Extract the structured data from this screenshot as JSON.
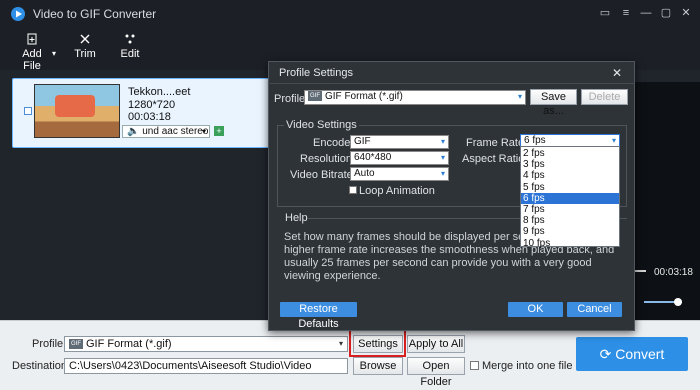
{
  "app": {
    "title": "Video to GIF Converter"
  },
  "titlebar": {
    "ctrls": [
      "▭",
      "≡",
      "—",
      "▢",
      "✕"
    ]
  },
  "toolbar": {
    "add_file": "Add File",
    "trim": "Trim",
    "edit": "Edit",
    "add_caret": "▾"
  },
  "file": {
    "name": "Tekkon....eet",
    "resolution": "1280*720",
    "duration": "00:03:18",
    "audio": "und aac stereo"
  },
  "preview": {
    "time": "00:03:18",
    "seek_progress": 0.06,
    "volume": 0.8
  },
  "dialog": {
    "title": "Profile Settings",
    "profile_label": "Profile:",
    "profile_value": "GIF Format (*.gif)",
    "save_as": "Save as...",
    "delete": "Delete",
    "video_settings": "Video Settings",
    "encoder_label": "Encoder:",
    "encoder_value": "GIF",
    "resolution_label": "Resolution:",
    "resolution_value": "640*480",
    "bitrate_label": "Video Bitrate:",
    "bitrate_value": "Auto",
    "loop_label": "Loop Animation",
    "framerate_label": "Frame Rate:",
    "framerate_value": "6 fps",
    "aspect_label": "Aspect Ratio:",
    "help_title": "Help",
    "help_text": "Set how many frames should be displayed per second (FPS). A higher frame rate increases the smoothness when played back, and usually 25 frames per second can provide you with a very good viewing experience.",
    "restore": "Restore Defaults",
    "ok": "OK",
    "cancel": "Cancel"
  },
  "fps_options": [
    "2 fps",
    "3 fps",
    "4 fps",
    "5 fps",
    "6 fps",
    "7 fps",
    "8 fps",
    "9 fps",
    "10 fps"
  ],
  "fps_selected": "6 fps",
  "bottom": {
    "profile_label": "Profile:",
    "profile_value": "GIF Format (*.gif)",
    "settings": "Settings",
    "apply_all": "Apply to All",
    "destination_label": "Destination:",
    "destination_value": "C:\\Users\\0423\\Documents\\Aiseesoft Studio\\Video",
    "browse": "Browse",
    "open_folder": "Open Folder",
    "merge": "Merge into one file",
    "convert": "Convert"
  },
  "colors": {
    "accent": "#2d8fe6",
    "highlight": "#d81e1e",
    "selected": "#2b74d6"
  }
}
